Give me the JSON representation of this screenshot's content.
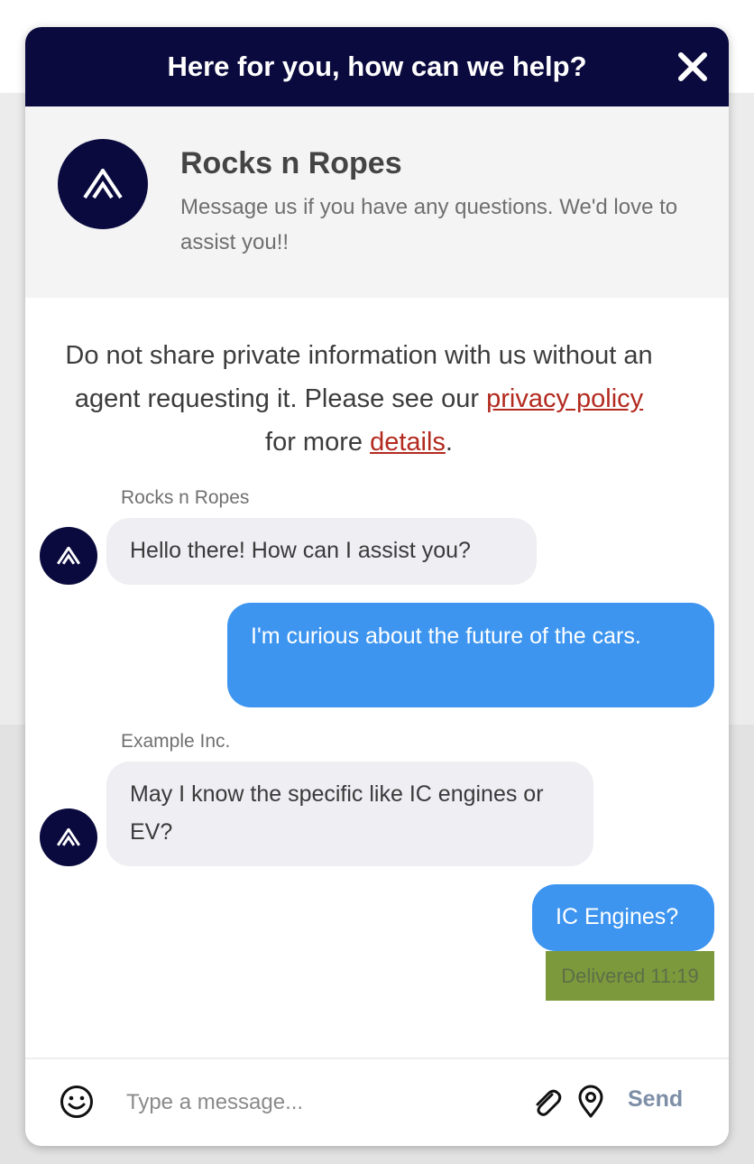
{
  "header": {
    "title": "Here for you, how can we help?"
  },
  "brand": {
    "name": "Rocks n Ropes",
    "description": "Message us if you have any questions. We'd love to assist you!!"
  },
  "notice": {
    "text_before": "Do not share private information with us without an agent requesting it. Please see our ",
    "privacy_link": "privacy policy",
    "text_middle": " for more ",
    "details_link": "details",
    "text_after": "."
  },
  "messages": [
    {
      "sender": "Rocks n Ropes",
      "text": "Hello there! How can I assist you?",
      "direction": "incoming"
    },
    {
      "text": "I'm curious about the future of the cars.",
      "direction": "outgoing"
    },
    {
      "sender": "Example Inc.",
      "text": "May I know the specific like IC engines or EV?",
      "direction": "incoming"
    },
    {
      "text": "IC Engines?",
      "direction": "outgoing"
    }
  ],
  "delivery_status": "Delivered 11:19",
  "composer": {
    "placeholder": "Type a message...",
    "send_label": "Send"
  },
  "colors": {
    "header_bg": "#0a0a3f",
    "outgoing_bubble": "#3d95f0",
    "incoming_bubble": "#eeeef3",
    "link": "#b32a1f",
    "delivered_bg": "#7c9a3c"
  },
  "icons": [
    "close-icon",
    "brand-logo-icon",
    "emoji-icon",
    "paperclip-icon",
    "location-pin-icon"
  ]
}
